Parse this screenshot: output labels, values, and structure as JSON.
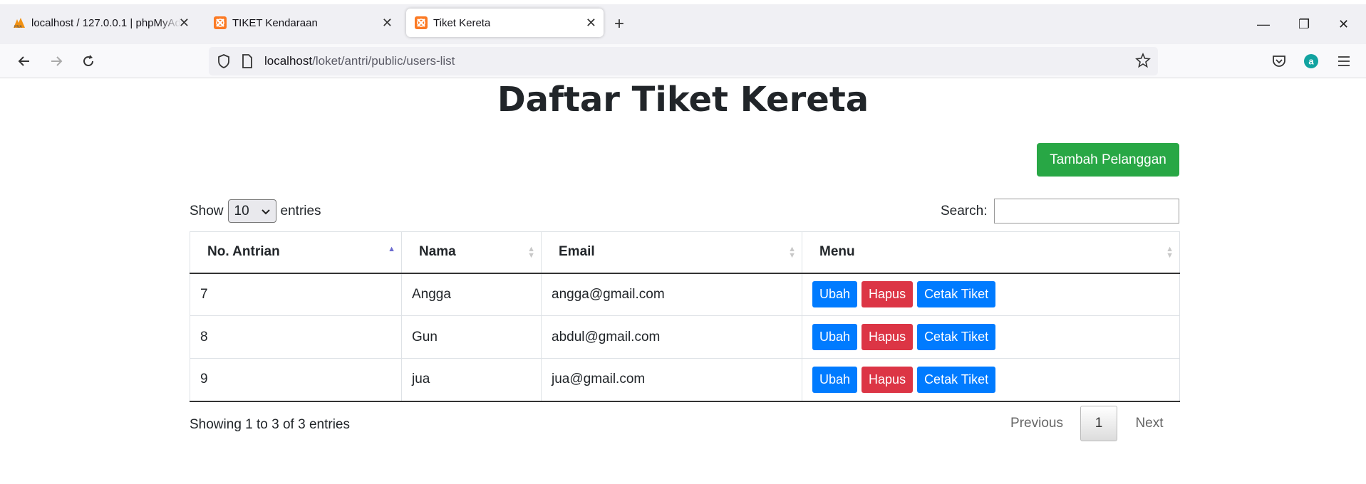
{
  "browser": {
    "tabs": [
      {
        "title": "localhost / 127.0.0.1 | phpMyAdmin",
        "icon": "phpmyadmin-icon"
      },
      {
        "title": "TIKET Kendaraan",
        "icon": "xampp-icon"
      },
      {
        "title": "Tiket Kereta",
        "icon": "xampp-icon",
        "active": true
      }
    ],
    "url_host": "localhost",
    "url_path": "/loket/antri/public/users-list"
  },
  "page": {
    "title": "Daftar Tiket Kereta",
    "add_button": "Tambah Pelanggan",
    "show_label": "Show",
    "entries_value": "10",
    "entries_label": "entries",
    "search_label": "Search:",
    "search_value": ""
  },
  "table": {
    "headers": [
      "No. Antrian",
      "Nama",
      "Email",
      "Menu"
    ],
    "rows": [
      {
        "no": "7",
        "nama": "Angga",
        "email": "angga@gmail.com"
      },
      {
        "no": "8",
        "nama": "Gun",
        "email": "abdul@gmail.com"
      },
      {
        "no": "9",
        "nama": "jua",
        "email": "jua@gmail.com"
      }
    ],
    "actions": {
      "edit": "Ubah",
      "delete": "Hapus",
      "print": "Cetak Tiket"
    }
  },
  "footer": {
    "info": "Showing 1 to 3 of 3 entries",
    "previous": "Previous",
    "current_page": "1",
    "next": "Next"
  },
  "colors": {
    "success": "#28a745",
    "primary": "#007bff",
    "danger": "#dc3545"
  }
}
